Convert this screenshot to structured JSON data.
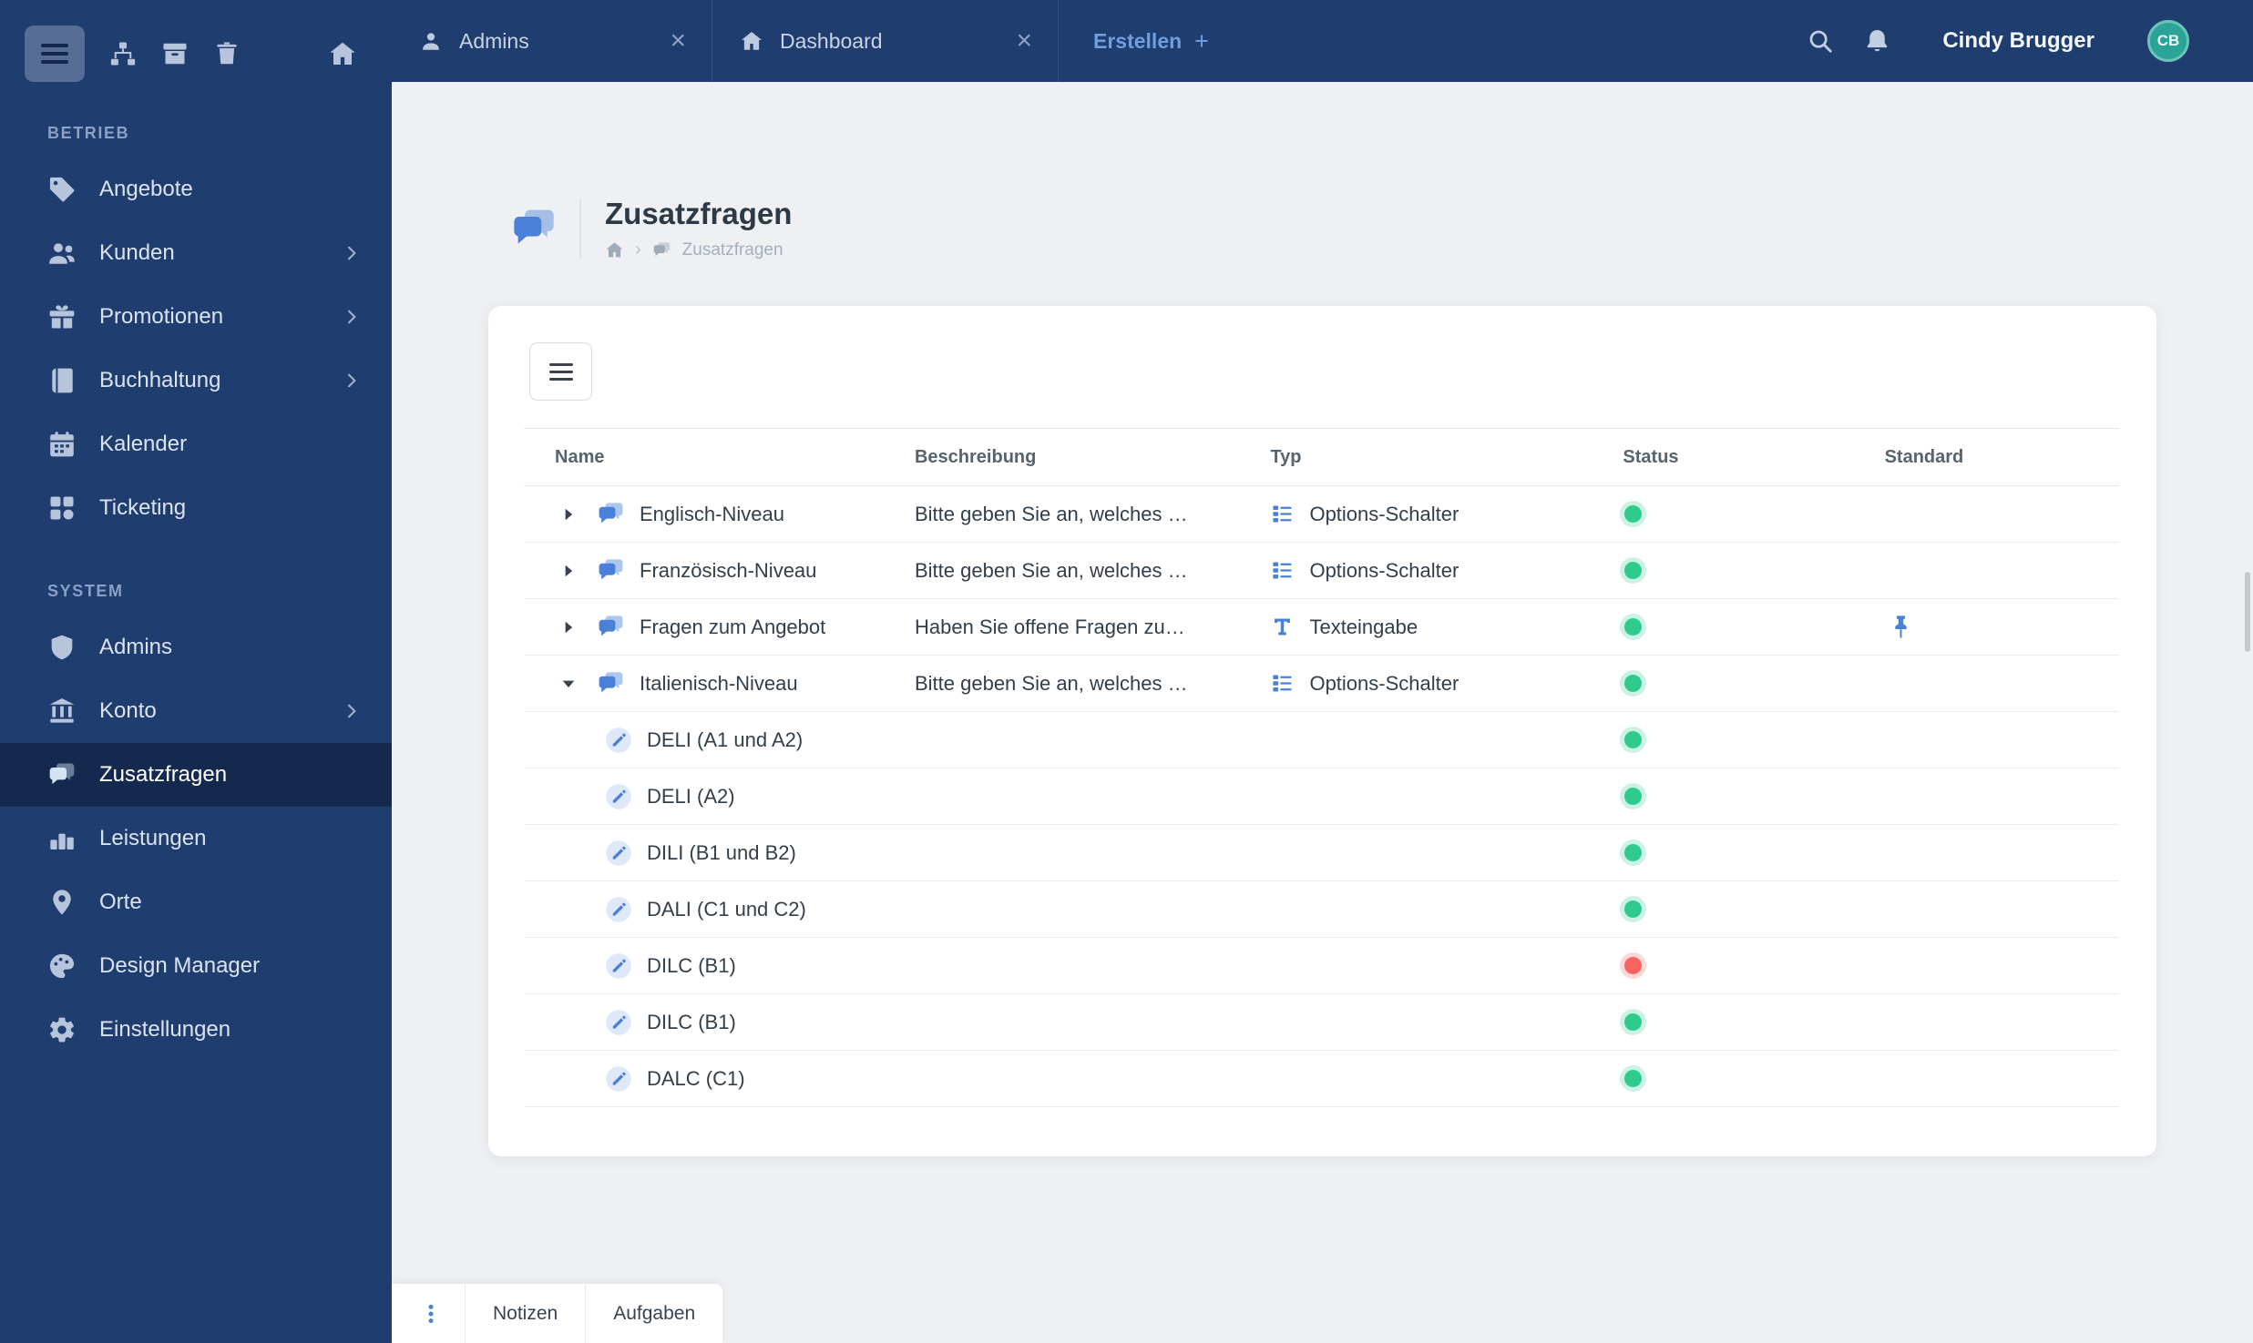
{
  "topbar": {
    "tabs": [
      {
        "label": "Admins",
        "close": "×"
      },
      {
        "label": "Dashboard",
        "close": "×"
      }
    ],
    "new_tab": {
      "label": "Erstellen",
      "plus": "+"
    },
    "user": {
      "name": "Cindy Brugger",
      "initials": "CB"
    }
  },
  "sidebar": {
    "sections": [
      {
        "label": "BETRIEB",
        "items": [
          {
            "label": "Angebote"
          },
          {
            "label": "Kunden"
          },
          {
            "label": "Promotionen"
          },
          {
            "label": "Buchhaltung"
          },
          {
            "label": "Kalender"
          },
          {
            "label": "Ticketing"
          }
        ]
      },
      {
        "label": "SYSTEM",
        "items": [
          {
            "label": "Admins"
          },
          {
            "label": "Konto"
          },
          {
            "label": "Zusatzfragen"
          },
          {
            "label": "Leistungen"
          },
          {
            "label": "Orte"
          },
          {
            "label": "Design Manager"
          },
          {
            "label": "Einstellungen"
          }
        ]
      }
    ]
  },
  "page": {
    "title": "Zusatzfragen",
    "breadcrumb": {
      "separator": "›",
      "current": "Zusatzfragen"
    }
  },
  "table": {
    "headers": [
      "Name",
      "Beschreibung",
      "Typ",
      "Status",
      "Standard"
    ],
    "rows": [
      {
        "name": "Englisch-Niveau",
        "description": "Bitte geben Sie an, welches …",
        "type": "Options-Schalter",
        "status": "active"
      },
      {
        "name": "Französisch-Niveau",
        "description": "Bitte geben Sie an, welches …",
        "type": "Options-Schalter",
        "status": "active"
      },
      {
        "name": "Fragen zum Angebot",
        "description": "Haben Sie offene Fragen zu…",
        "type": "Texteingabe",
        "status": "active",
        "standard": true
      },
      {
        "name": "Italienisch-Niveau",
        "description": "Bitte geben Sie an, welches …",
        "type": "Options-Schalter",
        "status": "active",
        "expanded": true
      },
      {
        "name": "DELI (A1 und A2)",
        "status": "active",
        "child": true
      },
      {
        "name": "DELI (A2)",
        "status": "active",
        "child": true
      },
      {
        "name": "DILI (B1 und B2)",
        "status": "active",
        "child": true
      },
      {
        "name": "DALI (C1 und C2)",
        "status": "active",
        "child": true
      },
      {
        "name": "DILC (B1)",
        "status": "inactive",
        "child": true
      },
      {
        "name": "DILC (B1)",
        "status": "active",
        "child": true
      },
      {
        "name": "DALC (C1)",
        "status": "active",
        "child": true
      }
    ]
  },
  "footer": {
    "tabs": [
      {
        "label": "Notizen"
      },
      {
        "label": "Aufgaben"
      }
    ]
  },
  "colors": {
    "sidebar_navy": "#1f3d6e",
    "sidebar_active": "#15294f",
    "accent_blue": "#4a80d8",
    "status_green": "#2fcb8e",
    "status_red": "#f96360",
    "avatar_teal": "#2aa398",
    "content_bg": "#eef0f3"
  },
  "icons": {
    "hamburger-icon": "three-bars",
    "sitemap-icon": "tree-nodes",
    "archive-icon": "box",
    "trash-icon": "trash-can",
    "home-icon": "house",
    "search-icon": "magnifier",
    "bell-icon": "notification-bell",
    "question-icon": "double-chat-bubble",
    "pencil-icon": "pencil-in-circle",
    "options-type-icon": "checklist",
    "text-type-icon": "letter-T",
    "standard-pin-icon": "pushpin",
    "status-dot": "filled-circle"
  }
}
